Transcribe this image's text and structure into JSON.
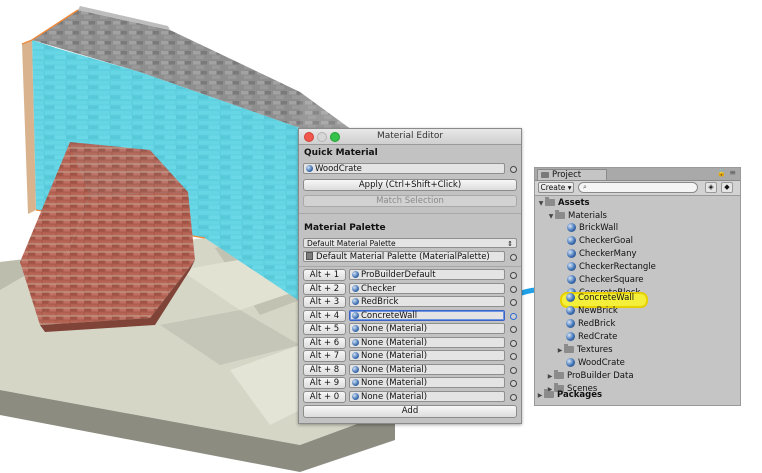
{
  "material_editor": {
    "title": "Material Editor",
    "quick_material": {
      "heading": "Quick Material",
      "material": "WoodCrate",
      "apply_label": "Apply (Ctrl+Shift+Click)",
      "match_label": "Match Selection"
    },
    "palette": {
      "heading": "Material Palette",
      "dropdown_value": "Default Material Palette",
      "asset_field": "Default Material Palette (MaterialPalette)",
      "slots": [
        {
          "hotkey": "Alt + 1",
          "material": "ProBuilderDefault"
        },
        {
          "hotkey": "Alt + 2",
          "material": "Checker"
        },
        {
          "hotkey": "Alt + 3",
          "material": "RedBrick"
        },
        {
          "hotkey": "Alt + 4",
          "material": "ConcreteWall"
        },
        {
          "hotkey": "Alt + 5",
          "material": "None (Material)"
        },
        {
          "hotkey": "Alt + 6",
          "material": "None (Material)"
        },
        {
          "hotkey": "Alt + 7",
          "material": "None (Material)"
        },
        {
          "hotkey": "Alt + 8",
          "material": "None (Material)"
        },
        {
          "hotkey": "Alt + 9",
          "material": "None (Material)"
        },
        {
          "hotkey": "Alt + 0",
          "material": "None (Material)"
        }
      ],
      "add_label": "Add"
    }
  },
  "project": {
    "tab_label": "Project",
    "create_label": "Create",
    "tree": {
      "assets": "Assets",
      "materials_folder": "Materials",
      "materials": [
        "BrickWall",
        "CheckerGoal",
        "CheckerMany",
        "CheckerRectangle",
        "CheckerSquare",
        "ConcreteBlock",
        "ConcreteWall",
        "NewBrick",
        "RedBrick",
        "RedCrate"
      ],
      "textures_folder": "Textures",
      "woodcrate": "WoodCrate",
      "probuilder_data": "ProBuilder Data",
      "scenes": "Scenes",
      "packages": "Packages"
    },
    "highlighted_item": "ConcreteWall"
  },
  "colors": {
    "highlight": "#f3ef3a",
    "drag_arrow": "#1ea0e8",
    "cyan_wall": "#5fd0e0",
    "selection_border": "#3a63c8"
  }
}
